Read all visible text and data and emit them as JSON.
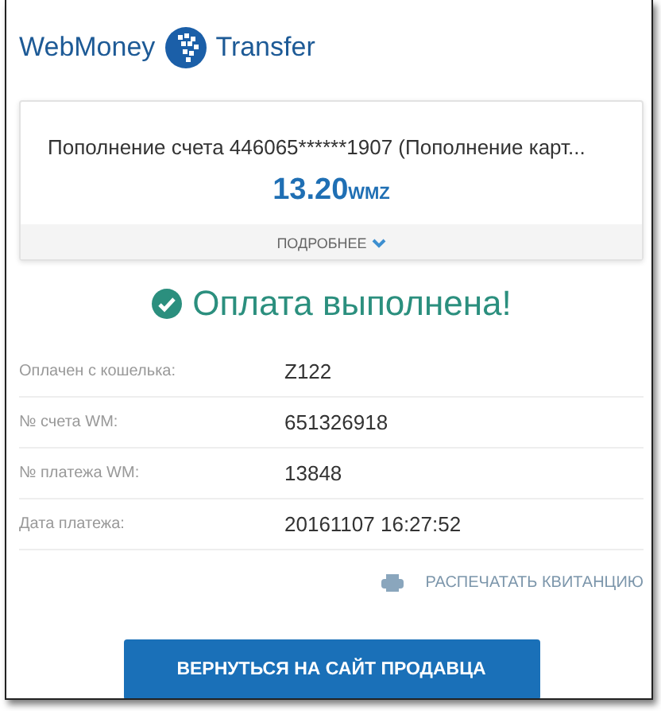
{
  "logo": {
    "left": "WebMoney",
    "right": "Transfer"
  },
  "payment": {
    "description": "Пополнение счета 446065******1907 (Пополнение карт...",
    "amount": "13.20",
    "currency": "WMZ",
    "details_link": "ПОДРОБНЕЕ"
  },
  "status": "Оплата выполнена!",
  "fields": [
    {
      "label": "Оплачен с кошелька:",
      "value": "Z122"
    },
    {
      "label": "№ счета WM:",
      "value": "651326918"
    },
    {
      "label": "№ платежа WM:",
      "value": "13848"
    },
    {
      "label": "Дата платежа:",
      "value": "20161107 16:27:52"
    }
  ],
  "print_link": "РАСПЕЧАТАТЬ КВИТАНЦИЮ",
  "return_button": "ВЕРНУТЬСЯ НА САЙТ ПРОДАВЦА"
}
